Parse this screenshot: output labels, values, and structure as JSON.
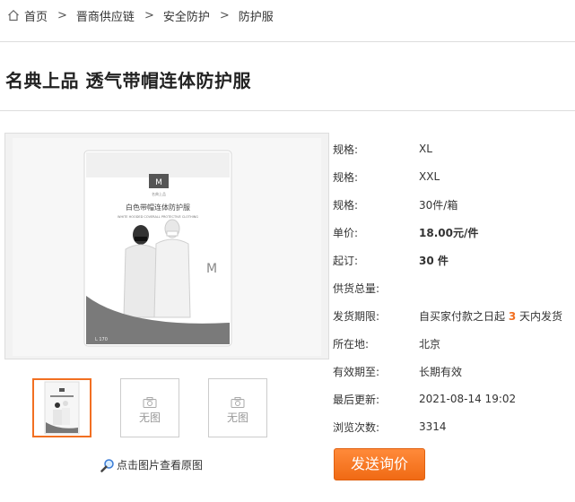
{
  "breadcrumb": {
    "items": [
      "首页",
      "晋商供应链",
      "安全防护",
      "防护服"
    ],
    "separator": ">"
  },
  "product": {
    "title": "名典上品 透气带帽连体防护服",
    "package_text": {
      "brand": "名典上品",
      "name": "白色带帽连体防护服",
      "english": "WHITE HOODED COVERALL PROTECTIVE CLOTHING",
      "size": "L 170"
    }
  },
  "gallery": {
    "no_image_label": "无图",
    "view_original": "点击图片查看原图"
  },
  "specs": [
    {
      "label": "规格:",
      "value": "XL"
    },
    {
      "label": "规格:",
      "value": "XXL"
    },
    {
      "label": "规格:",
      "value": "30件/箱"
    },
    {
      "label": "单价:",
      "value": "18.00元/件"
    },
    {
      "label": "起订:",
      "value": "30 件"
    },
    {
      "label": "供货总量:",
      "value": ""
    },
    {
      "label": "发货期限:",
      "value_prefix": "自买家付款之日起",
      "value_highlight": "3",
      "value_suffix": "天内发货"
    },
    {
      "label": "所在地:",
      "value": "北京"
    },
    {
      "label": "有效期至:",
      "value": "长期有效"
    },
    {
      "label": "最后更新:",
      "value": "2021-08-14 19:02"
    },
    {
      "label": "浏览次数:",
      "value": "3314"
    }
  ],
  "actions": {
    "inquiry_label": "发送询价"
  },
  "colors": {
    "accent": "#f26f21",
    "divider": "#dddddd"
  },
  "icons": [
    "home-icon",
    "chevron-right-icon",
    "camera-icon",
    "magnifier-icon"
  ]
}
